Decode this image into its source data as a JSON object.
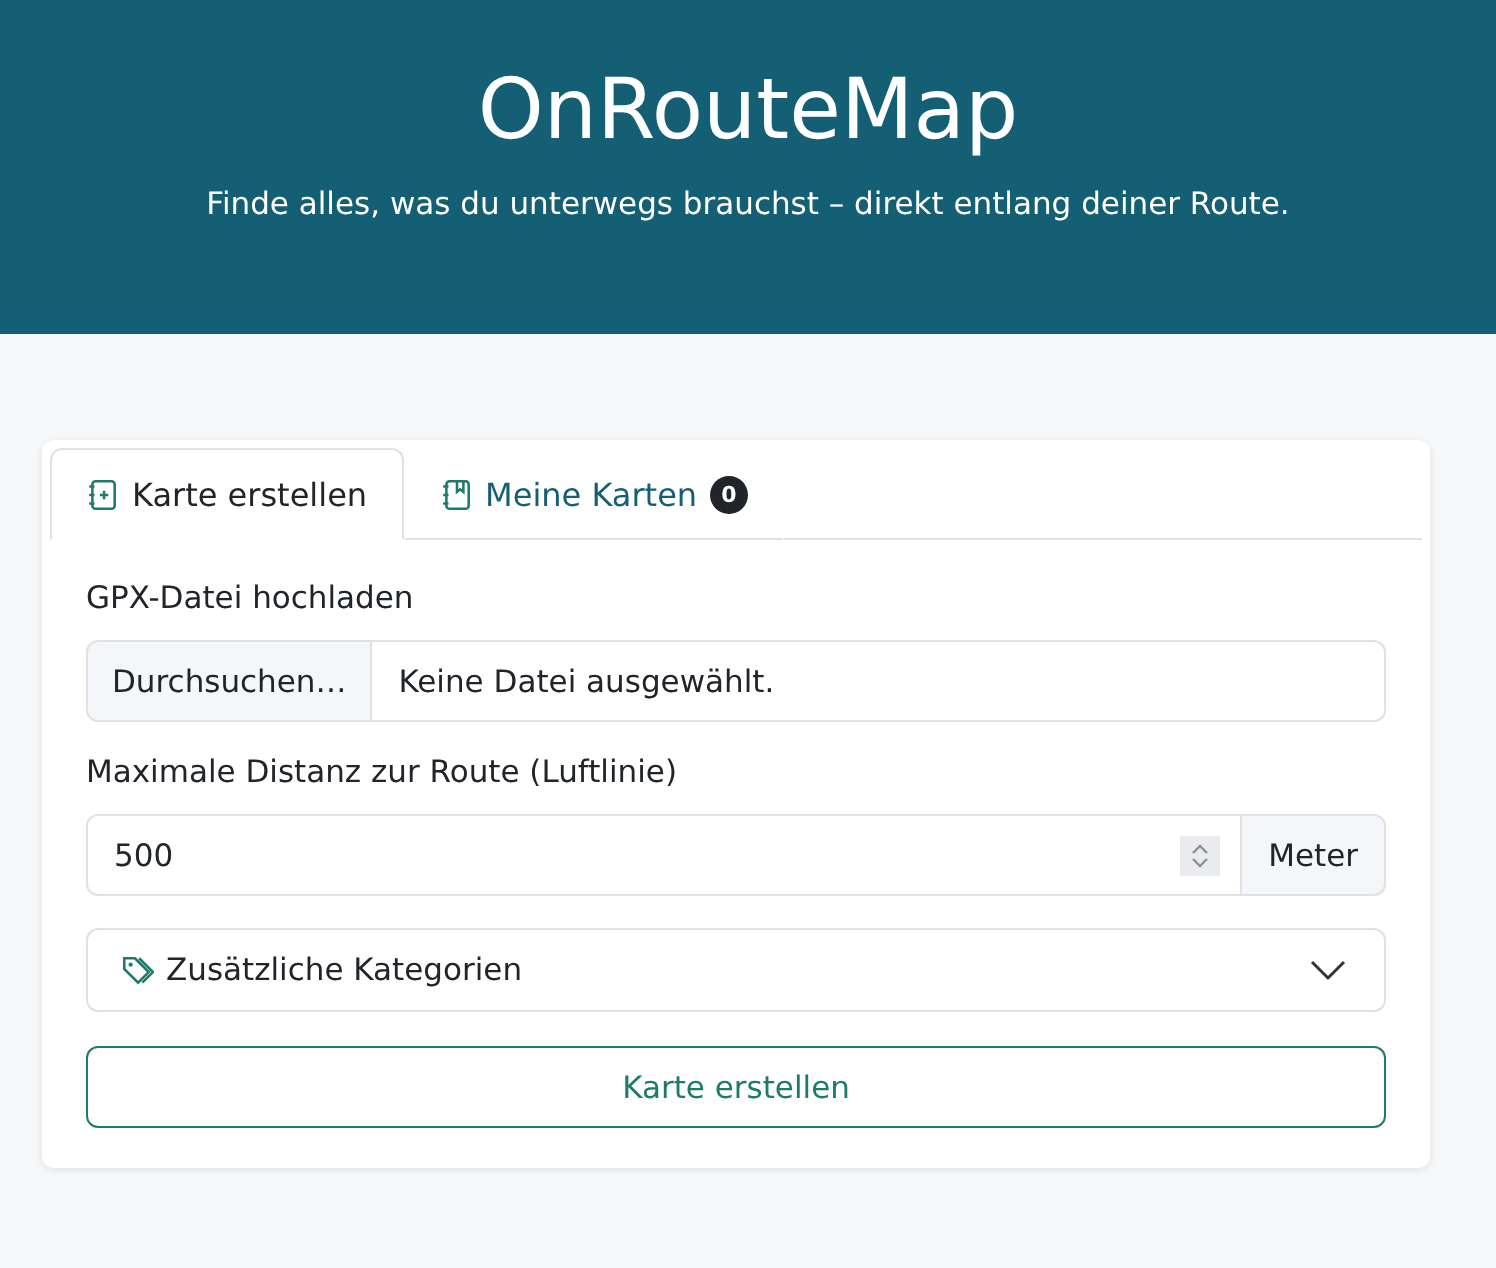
{
  "header": {
    "title": "OnRouteMap",
    "subtitle": "Finde alles, was du unterwegs brauchst – direkt entlang deiner Route."
  },
  "tabs": [
    {
      "label": "Karte erstellen",
      "selected": true,
      "kind": "create"
    },
    {
      "label": "Meine Karten",
      "selected": false,
      "kind": "list",
      "badge": "0"
    }
  ],
  "upload": {
    "label": "GPX-Datei hochladen",
    "button": "Durchsuchen…",
    "value": "Keine Datei ausgewählt."
  },
  "distance": {
    "label": "Maximale Distanz zur Route (Luftlinie)",
    "value": "500",
    "unit": "Meter"
  },
  "categories": {
    "label": "Zusätzliche Kategorien",
    "expanded": false
  },
  "submit": "Karte erstellen"
}
